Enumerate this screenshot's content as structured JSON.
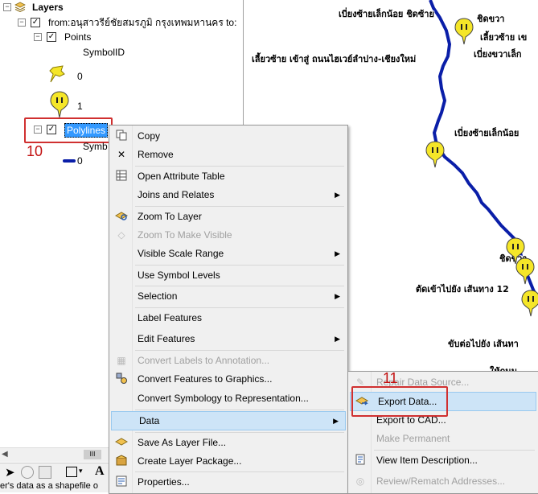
{
  "toc": {
    "root_label": "Layers",
    "layer1_label": "from:อนุสาวรีย์ชัยสมรภูมิ กรุงเทพมหานคร to:",
    "points_label": "Points",
    "points_field": "SymbolID",
    "points_class0": "0",
    "points_class1": "1",
    "polylines_label": "Polylines",
    "polylines_field": "Symb",
    "polylines_class0": "0",
    "callout_number": "10"
  },
  "map": {
    "labels": [
      "เบี่ยงซ้ายเล็กน้อย ชิดซ้าย",
      "ชิดขวา",
      "เลี้ยวซ้าย เข",
      "เบี่ยงขวาเล็ก",
      "เลี้ยวซ้าย เข้าสู่ ถนนไฮเวย์ลำปาง-เชียงใหม่",
      "เบี่ยงซ้ายเล็กน้อย",
      "ชิดขวา",
      "ตัดเข้าไปยัง เส้นทาง 12",
      "ขับต่อไปยัง เส้นทา",
      "ให้ถนน"
    ],
    "route_color": "#0a1ea8",
    "pin_color": "#f5e628"
  },
  "context_menu": {
    "items": [
      {
        "label": "Copy",
        "icon": "copy-icon"
      },
      {
        "label": "Remove",
        "icon": "remove-icon"
      },
      {
        "label": "Open Attribute Table",
        "icon": "table-icon"
      },
      {
        "label": "Joins and Relates",
        "submenu": true
      },
      {
        "label": "Zoom To Layer",
        "icon": "zoom-layer-icon"
      },
      {
        "label": "Zoom To Make Visible",
        "disabled": true
      },
      {
        "label": "Visible Scale Range",
        "submenu": true
      },
      {
        "label": "Use Symbol Levels"
      },
      {
        "label": "Selection",
        "submenu": true
      },
      {
        "label": "Label Features"
      },
      {
        "label": "Edit Features",
        "submenu": true
      },
      {
        "label": "Convert Labels to Annotation...",
        "disabled": true
      },
      {
        "label": "Convert Features to Graphics..."
      },
      {
        "label": "Convert Symbology to Representation..."
      },
      {
        "label": "Data",
        "submenu": true,
        "highlighted": true
      },
      {
        "label": "Save As Layer File..."
      },
      {
        "label": "Create Layer Package..."
      },
      {
        "label": "Properties..."
      }
    ]
  },
  "data_submenu": {
    "items": [
      {
        "label": "Repair Data Source...",
        "disabled": true
      },
      {
        "label": "Export Data...",
        "highlighted": true
      },
      {
        "label": "Export to CAD..."
      },
      {
        "label": "Make Permanent",
        "disabled": true
      },
      {
        "label": "View Item Description..."
      },
      {
        "label": "Review/Rematch Addresses...",
        "disabled": true
      }
    ],
    "callout_number": "11"
  },
  "status_text": "er's data as a shapefile o"
}
